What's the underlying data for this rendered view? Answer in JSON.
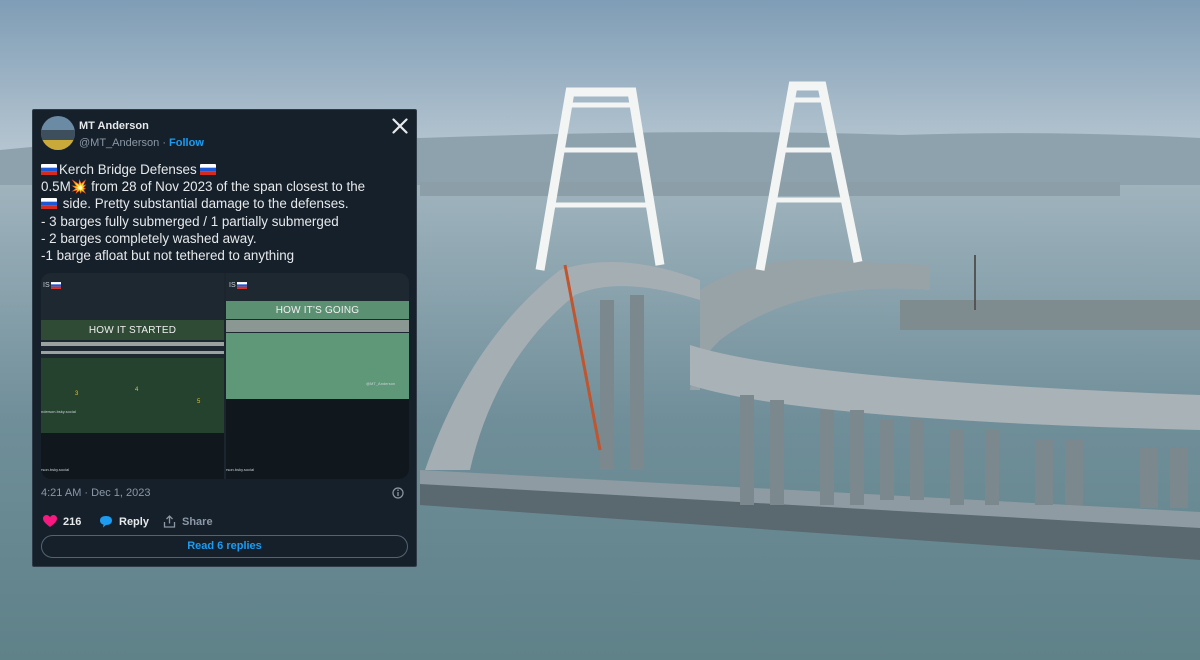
{
  "tweet": {
    "display_name": "MT Anderson",
    "handle": "@MT_Anderson",
    "separator": " · ",
    "follow_label": "Follow",
    "lines": [
      "Kerch Bridge Defenses ",
      "0.5M💥 from 28 of Nov 2023 of the span closest to the",
      " side. Pretty substantial damage to the defenses.",
      "- 3 barges fully submerged / 1 partially submerged",
      "- 2 barges completely washed away.",
      "-1 barge afloat but not tethered to anything"
    ],
    "media": {
      "left_label": "HOW IT STARTED",
      "right_label": "HOW IT'S GOING",
      "left_corner": "IS",
      "right_corner": "IS",
      "markers": [
        "3",
        "4",
        "5"
      ],
      "credit_left": "nderson.bsky.social",
      "credit_left_2": "rson.bsky.social",
      "credit_right": "rson.bsky.social",
      "credit_right_top": "@MT_Anderson"
    },
    "timestamp": "4:21 AM · Dec 1, 2023",
    "likes": "216",
    "reply_label": "Reply",
    "share_label": "Share",
    "read_replies_label": "Read 6 replies",
    "colors": {
      "accent": "#1d9bf0",
      "like": "#f91880",
      "background": "#15202b"
    }
  }
}
